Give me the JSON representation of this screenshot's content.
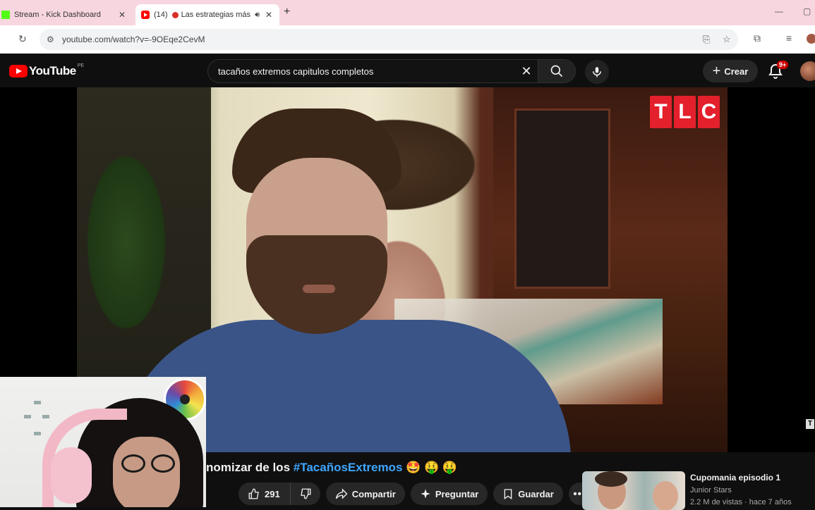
{
  "browser": {
    "tabs": [
      {
        "title": "Stream - Kick Dashboard",
        "close": "✕"
      },
      {
        "prefix": "(14)",
        "title": "Las estrategias más",
        "close": "✕"
      }
    ],
    "new_tab": "+",
    "url": "youtube.com/watch?v=-9OEqe2CevM"
  },
  "youtube": {
    "logo_text": "YouTube",
    "country_code": "PE",
    "search_query": "tacaños extremos capitulos completos",
    "clear_label": "✕",
    "create_label": "Crear",
    "notifications_badge": "9+"
  },
  "video": {
    "channel_bug": [
      "T",
      "L",
      "C"
    ],
    "overlay_icon": "T",
    "title_parts": {
      "lead": "nomizar de los ",
      "hashtag": "#TacañosExtremos",
      "emojis": " 🤩 🤑 🤑"
    },
    "actions": {
      "likes": "291",
      "share": "Compartir",
      "ask": "Preguntar",
      "save": "Guardar",
      "more": "•••"
    }
  },
  "recommendation": {
    "title": "Cupomania episodio 1",
    "channel": "Junior Stars",
    "meta": "2.2 M de vistas · hace 7 años"
  }
}
